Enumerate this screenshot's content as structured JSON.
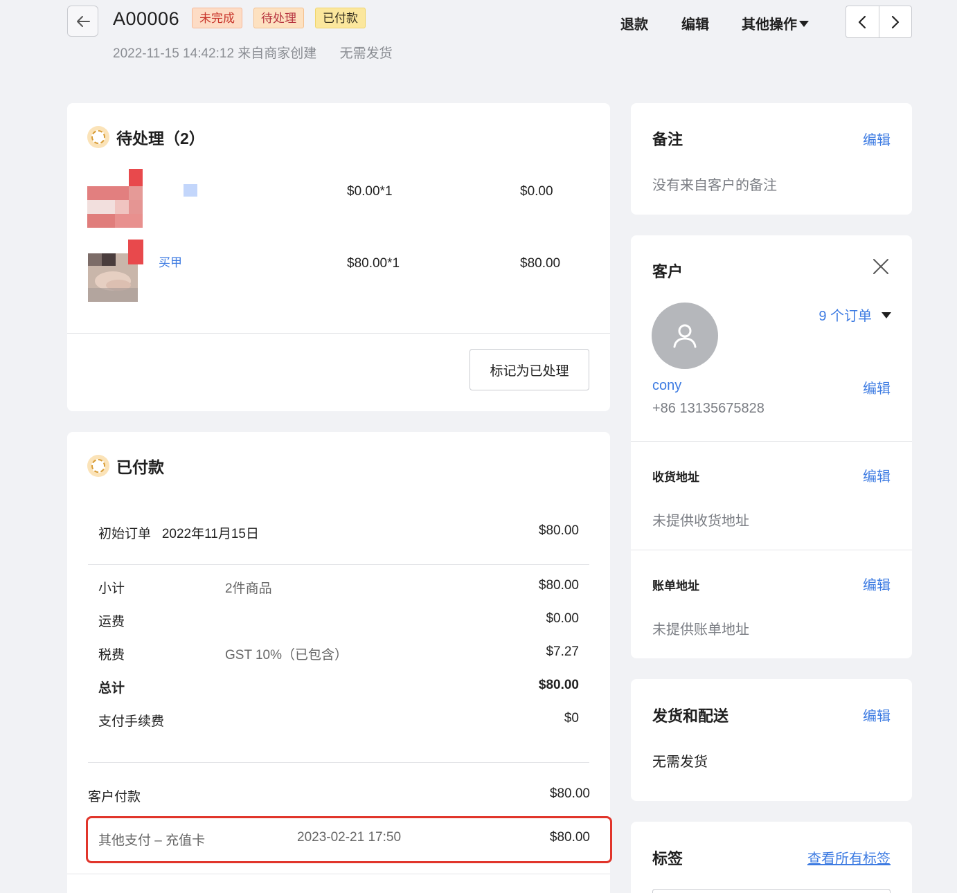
{
  "header": {
    "order_id": "A00006",
    "badges": [
      "未完成",
      "待处理",
      "已付款"
    ],
    "created": "2022-11-15 14:42:12 来自商家创建",
    "shipping_status": "无需发货",
    "actions": {
      "refund": "退款",
      "edit": "编辑",
      "more": "其他操作"
    }
  },
  "pending": {
    "title": "待处理（2）",
    "items": [
      {
        "name": "",
        "unit": "$0.00*1",
        "total": "$0.00"
      },
      {
        "name": "买甲",
        "unit": "$80.00*1",
        "total": "$80.00"
      }
    ],
    "mark_button": "标记为已处理"
  },
  "paid": {
    "title": "已付款",
    "original_label": "初始订单",
    "original_date": "2022年11月15日",
    "original_amount": "$80.00",
    "rows": [
      {
        "label": "小计",
        "desc": "2件商品",
        "amount": "$80.00"
      },
      {
        "label": "运费",
        "desc": "",
        "amount": "$0.00"
      },
      {
        "label": "税费",
        "desc": "GST 10%（已包含）",
        "amount": "$7.27"
      },
      {
        "label": "总计",
        "desc": "",
        "amount": "$80.00"
      },
      {
        "label": "支付手续费",
        "desc": "",
        "amount": "$0"
      }
    ],
    "customer_paid_label": "客户付款",
    "customer_paid_amount": "$80.00",
    "payment_method": "其他支付 – 充值卡",
    "payment_time": "2023-02-21 17:50",
    "payment_amount": "$80.00"
  },
  "notes": {
    "title": "备注",
    "edit": "编辑",
    "text": "没有来自客户的备注"
  },
  "customer": {
    "title": "客户",
    "orders": "9 个订单",
    "name": "cony",
    "edit": "编辑",
    "phone": "+86 13135675828",
    "shipping_title": "收货地址",
    "shipping_edit": "编辑",
    "shipping_text": "未提供收货地址",
    "billing_title": "账单地址",
    "billing_edit": "编辑",
    "billing_text": "未提供账单地址"
  },
  "delivery": {
    "title": "发货和配送",
    "edit": "编辑",
    "text": "无需发货"
  },
  "tags": {
    "title": "标签",
    "view_all": "查看所有标签"
  },
  "colors": {
    "accent": "#3d7be2",
    "highlight": "#e1352b",
    "background": "#f1f2f5"
  }
}
